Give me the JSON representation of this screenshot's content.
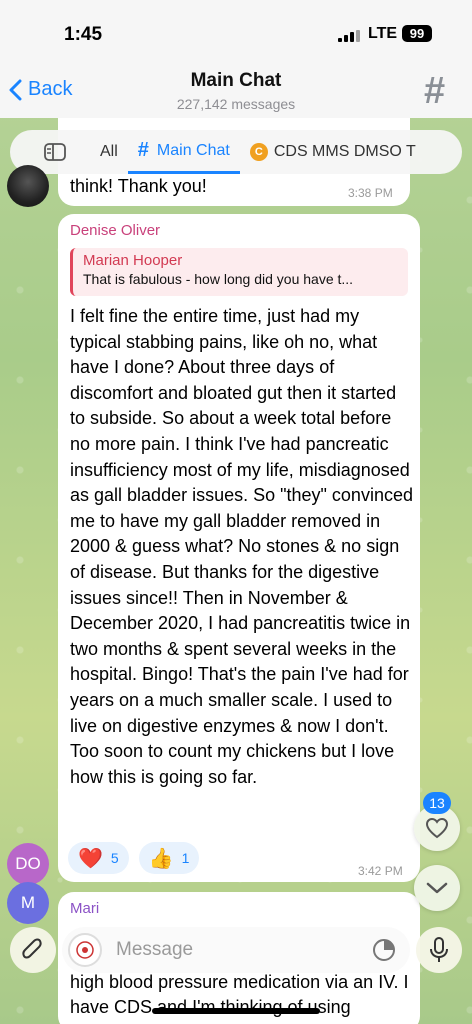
{
  "status_bar": {
    "time": "1:45",
    "network": "LTE",
    "battery": "99"
  },
  "header": {
    "back_label": "Back",
    "title": "Main Chat",
    "subtitle": "227,142 messages"
  },
  "tabs": [
    {
      "label": "All"
    },
    {
      "label": "Main Chat"
    },
    {
      "label": "CDS MMS DMSO T"
    }
  ],
  "messages": {
    "previous": {
      "text": "think!  Thank you!",
      "time": "3:38 PM"
    },
    "main": {
      "sender": "Denise Oliver",
      "reply_name": "Marian Hooper",
      "reply_text": "That is fabulous - how long did you have t...",
      "text": "I felt fine the entire time, just had my typical stabbing pains, like oh no, what have I done? About three days of discomfort and bloated gut then it started to subside. So about a week total before no more pain. I think I've had pancreatic insufficiency most of my life, misdiagnosed as gall bladder issues. So \"they\" convinced me to have my gall bladder removed in 2000 & guess what? No stones & no sign of disease. But thanks for the digestive issues since!! Then in November & December 2020, I had pancreatitis twice in two months & spent several weeks in the hospital. Bingo! That's the pain I've had for years on a much smaller scale. I used to live on digestive enzymes & now I don't. Too soon to count my chickens but I love how this is going so far.",
      "time": "3:42 PM",
      "reactions": [
        {
          "emoji": "❤️",
          "count": "5"
        },
        {
          "emoji": "👍",
          "count": "1"
        }
      ]
    },
    "next": {
      "sender": "Mari",
      "text_partial": "high blood pressure medication via an IV. I have CDS and I'm thinking of using"
    }
  },
  "avatars": {
    "do": "DO",
    "m": "M"
  },
  "floating": {
    "mentions_badge": "13"
  },
  "input": {
    "placeholder": "Message"
  },
  "colors": {
    "accent": "#1a84ff",
    "sender_denise": "#c9417b",
    "sender_mari": "#8b52c6",
    "reply_bar": "#e0455b"
  }
}
